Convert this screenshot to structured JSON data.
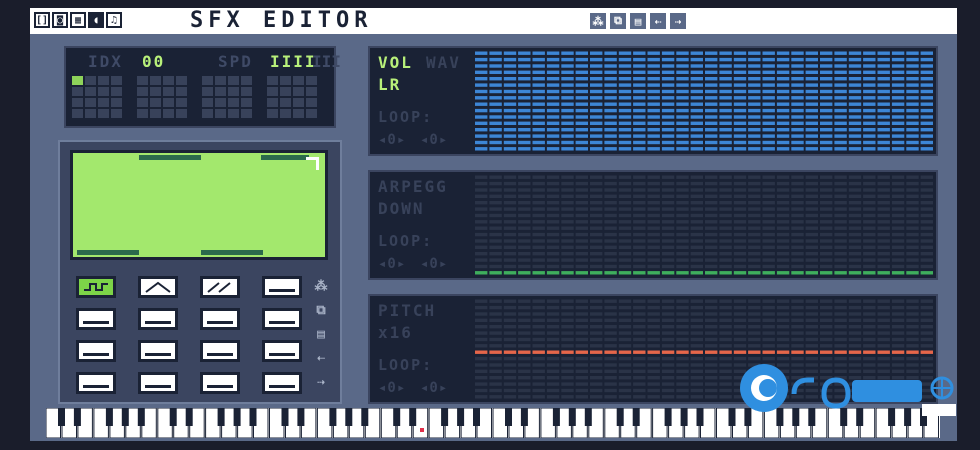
{
  "window": {
    "title": "SFX EDITOR"
  },
  "toolbar": {
    "left_icons": [
      "code-icon",
      "sprite-icon",
      "map-icon",
      "sfx-icon",
      "music-icon"
    ],
    "left_glyphs": [
      "[]",
      "◙",
      "▦",
      "◖",
      "♫"
    ],
    "right_icons": [
      "node-icon",
      "copy-icon",
      "paste-icon",
      "undo-icon",
      "redo-icon"
    ],
    "right_glyphs": [
      "⁂",
      "⧉",
      "▤",
      "⇠",
      "⇢"
    ]
  },
  "pattern": {
    "idx_label": "IDX",
    "idx_value": "00",
    "spd_label": "SPD",
    "spd_value": "IIII",
    "spd_rest": "III"
  },
  "waves": {
    "buttons": [
      "wave-square",
      "wave-triangle",
      "wave-saw",
      "wave-flat"
    ],
    "selected": 0,
    "side_icons": [
      "node-icon",
      "copy-icon",
      "paste-icon",
      "undo-icon",
      "redo-icon"
    ],
    "side_glyphs": [
      "⁂",
      "⧉",
      "▤",
      "⇠",
      "⇢"
    ]
  },
  "envelopes": [
    {
      "name1": "VOL",
      "name1b": "WAV",
      "name2": "LR",
      "loop_label": "LOOP:",
      "loop_a": "◂0▸",
      "loop_b": "◂0▸",
      "color": "#3d86d6",
      "level": 1.0
    },
    {
      "name1": "ARPEGG",
      "name1b": "",
      "name2": "DOWN",
      "loop_label": "LOOP:",
      "loop_a": "◂0▸",
      "loop_b": "◂0▸",
      "color": "#3fae5d",
      "level": 0.0
    },
    {
      "name1": "PITCH",
      "name1b": "",
      "name2": "x16",
      "loop_label": "LOOP:",
      "loop_a": "◂0▸",
      "loop_b": "◂0▸",
      "color": "#e5664a",
      "level": 0.5
    }
  ],
  "colors": {
    "accent": "#b8f07a",
    "screen": "#a3e86d",
    "panel": "#1a2235"
  }
}
